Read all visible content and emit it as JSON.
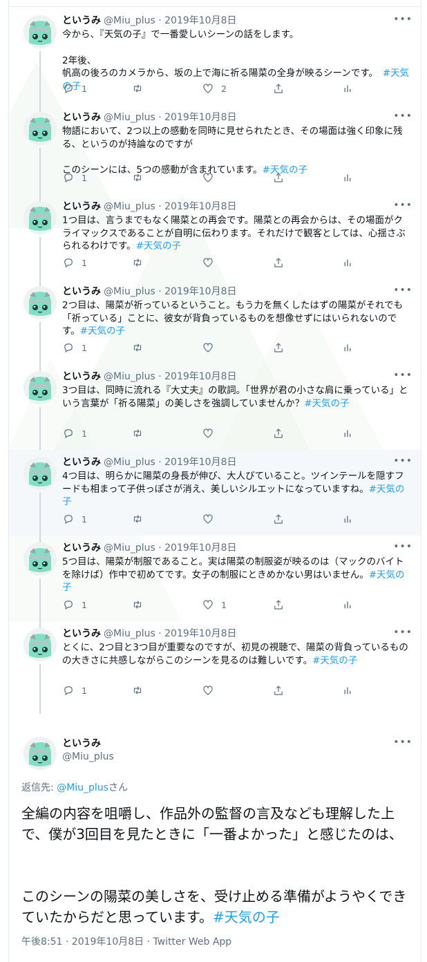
{
  "author": {
    "name": "というみ",
    "handle": "@Miu_plus",
    "date": "2019年10月8日",
    "more_icon": "ellipsis-icon"
  },
  "thread": [
    {
      "paragraphs": [
        [
          {
            "t": "今から、『天気の子』で一番愛しいシーンの話をします。"
          }
        ],
        [
          {
            "t": "2年後、"
          }
        ],
        [
          {
            "t": "帆高の後ろのカメラから、坂の上で海に祈る陽菜の全身が映るシーンです。　"
          },
          {
            "t": "#天気の子",
            "tag": true
          }
        ]
      ],
      "blank_after": [
        0
      ],
      "replies": "1",
      "retweets": "",
      "likes": "2"
    },
    {
      "paragraphs": [
        [
          {
            "t": "物語において、2つ以上の感動を同時に見せられたとき、その場面は強く印象に残る、というのが持論なのですが"
          }
        ],
        [
          {
            "t": "このシーンには、5つの感動が含まれています。"
          },
          {
            "t": "#天気の子",
            "tag": true
          }
        ]
      ],
      "blank_after": [
        0
      ],
      "replies": "1",
      "retweets": "",
      "likes": ""
    },
    {
      "paragraphs": [
        [
          {
            "t": "1つ目は、言うまでもなく陽菜との再会です。陽菜との再会からは、その場面がクライマックスであることが自明に伝わります。それだけで観客としては、心揺さぶられるわけです。"
          },
          {
            "t": "#天気の子",
            "tag": true
          }
        ]
      ],
      "blank_after": [],
      "replies": "1",
      "retweets": "",
      "likes": ""
    },
    {
      "paragraphs": [
        [
          {
            "t": "2つ目は、陽菜が祈っているということ。もう力を無くしたはずの陽菜がそれでも「祈っている」ことに、彼女が背負っているものを想像せずにはいられないのです。"
          },
          {
            "t": "#天気の子",
            "tag": true
          }
        ]
      ],
      "blank_after": [],
      "replies": "1",
      "retweets": "",
      "likes": ""
    },
    {
      "paragraphs": [
        [
          {
            "t": "3つ目は、同時に流れる『大丈夫』の歌詞。「世界が君の小さな肩に乗っている」という言葉が「祈る陽菜」の美しさを強調していませんか？"
          },
          {
            "t": "#天気の子",
            "tag": true
          }
        ]
      ],
      "blank_after": [],
      "replies": "1",
      "retweets": "",
      "likes": ""
    },
    {
      "paragraphs": [
        [
          {
            "t": "4つ目は、明らかに陽菜の身長が伸び、大人びていること。ツインテールを隠すフードも相まって子供っぽさが消え、美しいシルエットになっていますね。"
          },
          {
            "t": "#天気の子",
            "tag": true
          }
        ]
      ],
      "blank_after": [],
      "replies": "1",
      "retweets": "",
      "likes": ""
    },
    {
      "paragraphs": [
        [
          {
            "t": "5つ目は、陽菜が制服であること。実は陽菜の制服姿が映るのは（マックのバイトを除けば）作中で初めてです。女子の制服にときめかない男はいません。"
          },
          {
            "t": "#天気の子",
            "tag": true
          }
        ]
      ],
      "blank_after": [],
      "replies": "1",
      "retweets": "",
      "likes": "1"
    },
    {
      "paragraphs": [
        [
          {
            "t": "とくに、2つ目と3つ目が重要なのですが、初見の視聴で、陽菜の背負っているものの大きさに共感しながらこのシーンを見るのは難しいです。"
          },
          {
            "t": "#天気の子",
            "tag": true
          }
        ]
      ],
      "blank_after": [],
      "replies": "1",
      "retweets": "",
      "likes": ""
    }
  ],
  "main_tweet": {
    "name": "というみ",
    "handle": "@Miu_plus",
    "reply_prefix": "返信先: ",
    "reply_handle": "@Miu_plus",
    "reply_suffix": "さん",
    "line1": "全編の内容を咀嚼し、作品外の監督の言及なども理解した上で、僕が3回目を見たときに「一番よかった」と感じたのは、",
    "line2": "このシーンの陽菜の美しさを、受け止める準備がようやくできていたからだと思っています。",
    "hashtag": "#天気の子",
    "timestamp": "午後8:51 · 2019年10月8日 · Twitter Web App"
  },
  "icons": [
    "avatar",
    "reply-icon",
    "retweet-icon",
    "like-icon",
    "share-icon",
    "analytics-icon",
    "ellipsis-icon"
  ],
  "colors": {
    "link": "#1da1f2",
    "muted": "#5b7083",
    "highlight": "#f5f8fa"
  }
}
